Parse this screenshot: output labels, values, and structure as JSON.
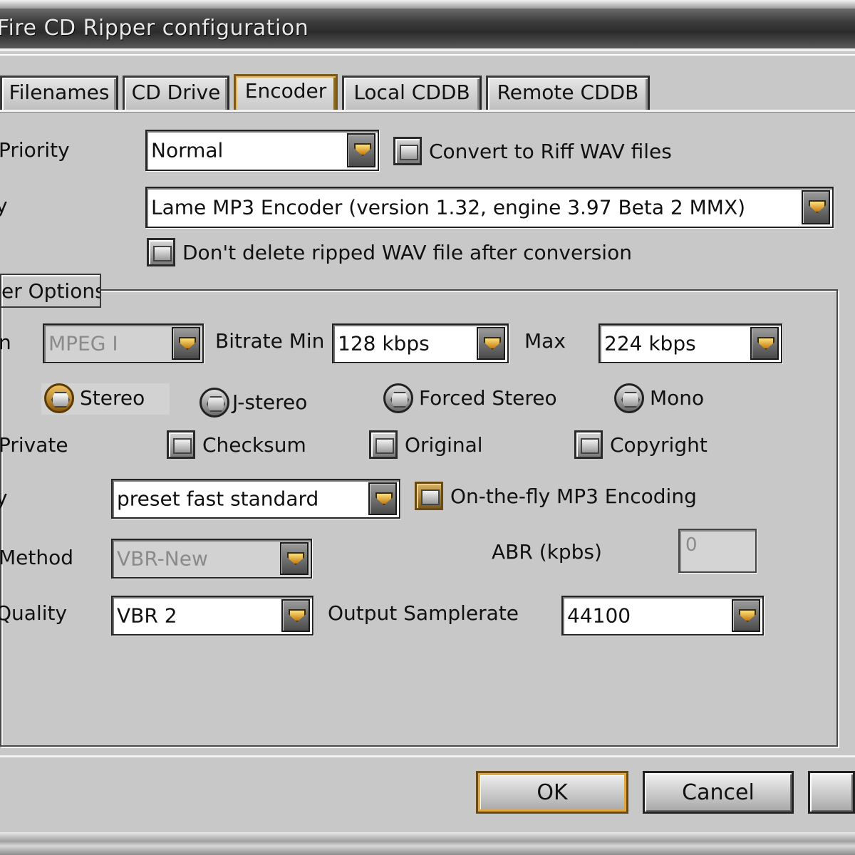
{
  "window": {
    "title": "Fire CD Ripper configuration"
  },
  "tabs": [
    {
      "label": "Filenames"
    },
    {
      "label": "CD Drive"
    },
    {
      "label": "Encoder"
    },
    {
      "label": "Local CDDB"
    },
    {
      "label": "Remote CDDB"
    }
  ],
  "active_tab": "Encoder",
  "top": {
    "priority_label": "Priority",
    "priority_value": "Normal",
    "convert_riff_label": "Convert to Riff WAV files",
    "encoder_label": "y",
    "encoder_value": "Lame MP3 Encoder (version 1.32, engine 3.97 Beta 2 MMX)",
    "dont_delete_label": "Don't delete ripped WAV file after conversion"
  },
  "group": {
    "title": "er Options",
    "version_label": "n",
    "version_value": "MPEG I",
    "bitrate_min_label": "Bitrate Min",
    "bitrate_min_value": "128 kbps",
    "max_label": "Max",
    "max_value": "224 kbps",
    "modes": {
      "stereo": "Stereo",
      "jstereo": "J-stereo",
      "forced": "Forced Stereo",
      "mono": "Mono"
    },
    "selected_mode": "Stereo",
    "private_label": "Private",
    "checksum_label": "Checksum",
    "original_label": "Original",
    "copyright_label": "Copyright",
    "preset_label": "y",
    "preset_value": "preset fast standard",
    "onthefly_label": "On-the-fly MP3 Encoding",
    "method_label": "Method",
    "method_value": "VBR-New",
    "abr_label": "ABR (kpbs)",
    "abr_value": "0",
    "quality_label": "Quality",
    "quality_value": "VBR 2",
    "samplerate_label": "Output Samplerate",
    "samplerate_value": "44100"
  },
  "buttons": {
    "ok": "OK",
    "cancel": "Cancel"
  },
  "colors": {
    "accent_gold": "#c47a10",
    "titlebar": "#2c2c2c",
    "face": "#c8c8c8"
  }
}
